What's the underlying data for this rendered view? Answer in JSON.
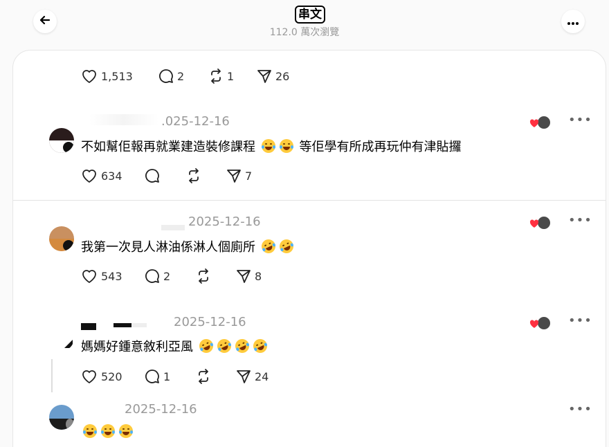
{
  "header": {
    "title": "串文",
    "views": "112.0 萬次瀏覽"
  },
  "post_actions": {
    "likes": "1,513",
    "comments": "2",
    "reposts": "1",
    "shares": "26"
  },
  "comments": [
    {
      "date": ".025-12-16",
      "text": "不如幫佢報再就業建造裝修課程",
      "text_after": "等佢學有所成再玩仲有津貼攞",
      "likes": "634",
      "comments": "",
      "reposts": "",
      "shares": "7"
    },
    {
      "date": "2025-12-16",
      "text": "我第一次見人淋油係淋人個廁所",
      "likes": "543",
      "comments": "2",
      "reposts": "",
      "shares": "8"
    },
    {
      "date": "2025-12-16",
      "text": "媽媽好鍾意敘利亞風",
      "likes": "520",
      "comments": "1",
      "reposts": "",
      "shares": "24"
    },
    {
      "date": "2025-12-16",
      "text": ""
    }
  ],
  "icons": {
    "back": "arrow-left-icon",
    "more": "more-horizontal-icon",
    "like": "heart-icon",
    "comment": "comment-bubble-icon",
    "repost": "repost-icon",
    "share": "send-icon"
  },
  "colors": {
    "heart_red": "#ff3040",
    "secondary_text": "#999999"
  }
}
